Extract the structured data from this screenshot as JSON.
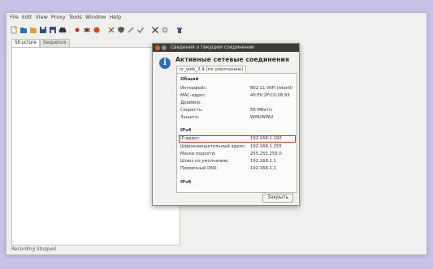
{
  "menubar": [
    "File",
    "Edit",
    "View",
    "Proxy",
    "Tools",
    "Window",
    "Help"
  ],
  "toolbar_icons": [
    "new-icon",
    "open-icon",
    "folder-icon",
    "save-icon",
    "save-as-icon",
    "binoculars-icon",
    "record-icon",
    "bug-icon",
    "stop-icon",
    "pen-icon",
    "shield-icon",
    "slash-icon",
    "check-icon",
    "tools-icon",
    "gear-icon",
    "broom-icon"
  ],
  "tabs": [
    "Structure",
    "Sequence"
  ],
  "status": "Recording Stopped",
  "dialog": {
    "title": "Сведения о текущем соединении",
    "heading": "Активные сетевые соединения",
    "connection_tab": "cr_web_2.4 (по умолчанию)",
    "general_title": "Общий",
    "general_rows": [
      {
        "label": "Интерфейс:",
        "value": "802.11 WiFi (wlan0)"
      },
      {
        "label": "MAC-адрес:",
        "value": "40:F0:2F:C0:08:93"
      },
      {
        "label": "Драйвер:",
        "value": ""
      },
      {
        "label": "Скорость:",
        "value": "58 Мбит/с"
      },
      {
        "label": "Защита:",
        "value": "WPA/WPA2"
      }
    ],
    "ipv4_title": "IPv4",
    "ipv4_rows": [
      {
        "label": "IP-адрес:",
        "value": "192.168.1.192"
      },
      {
        "label": "Широковещательный адрес:",
        "value": "192.168.1.255"
      },
      {
        "label": "Маска подсети:",
        "value": "255.255.255.0"
      },
      {
        "label": "Шлюз по умолчанию:",
        "value": "192.168.1.1"
      },
      {
        "label": "Первичный DNS:",
        "value": "192.168.1.1"
      }
    ],
    "ipv6_title": "IPv6",
    "close_label": "Закрыть"
  }
}
